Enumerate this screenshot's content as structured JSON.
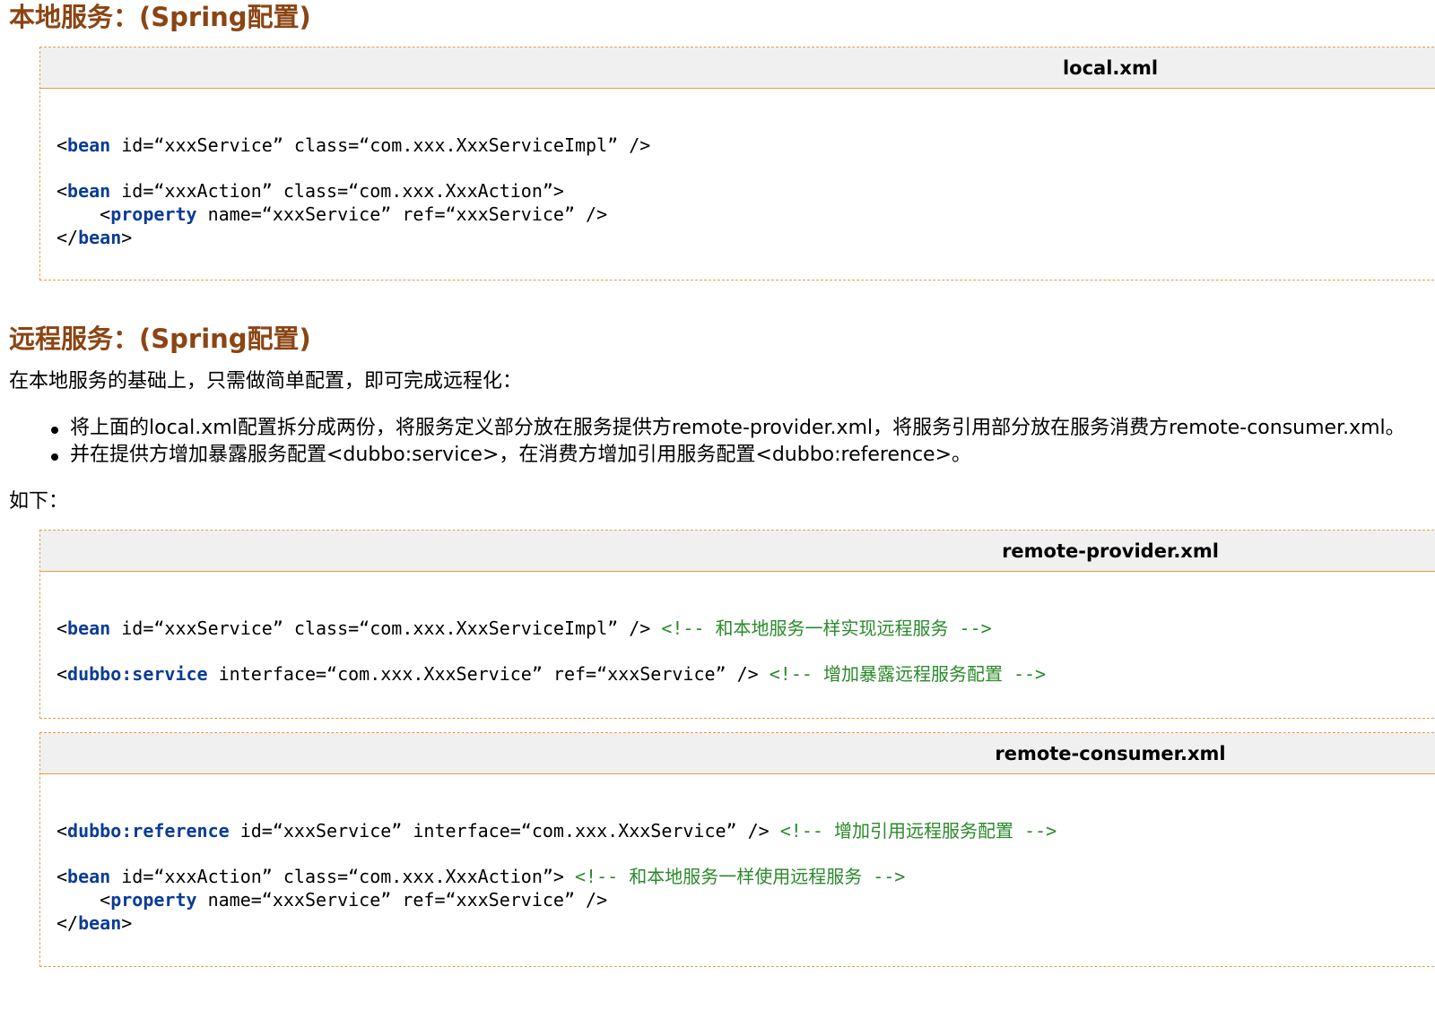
{
  "section1": {
    "heading": "本地服务：(Spring配置)",
    "file_title": "local.xml",
    "lines": [
      [],
      [],
      [
        {
          "t": "<"
        },
        {
          "t": "bean",
          "c": "tag"
        },
        {
          "t": " id=“xxxService” class=“com.xxx.XxxServiceImpl” />"
        }
      ],
      [],
      [
        {
          "t": "<"
        },
        {
          "t": "bean",
          "c": "tag"
        },
        {
          "t": " id=“xxxAction” class=“com.xxx.XxxAction”>"
        }
      ],
      [
        {
          "t": "    <"
        },
        {
          "t": "property",
          "c": "tag"
        },
        {
          "t": " name=“xxxService” ref=“xxxService” />"
        }
      ],
      [
        {
          "t": "</"
        },
        {
          "t": "bean",
          "c": "tag"
        },
        {
          "t": ">"
        }
      ]
    ]
  },
  "section2": {
    "heading": "远程服务：(Spring配置)",
    "intro": "在本地服务的基础上，只需做简单配置，即可完成远程化：",
    "bullets": [
      "将上面的local.xml配置拆分成两份，将服务定义部分放在服务提供方remote-provider.xml，将服务引用部分放在服务消费方remote-consumer.xml。",
      "并在提供方增加暴露服务配置<dubbo:service>，在消费方增加引用服务配置<dubbo:reference>。"
    ],
    "as_follows": "如下："
  },
  "provider": {
    "file_title": "remote-provider.xml",
    "lines": [
      [],
      [],
      [
        {
          "t": "<"
        },
        {
          "t": "bean",
          "c": "tag"
        },
        {
          "t": " id=“xxxService” class=“com.xxx.XxxServiceImpl” /> "
        },
        {
          "t": "<!-- 和本地服务一样实现远程服务 -->",
          "c": "cmt"
        }
      ],
      [],
      [
        {
          "t": "<"
        },
        {
          "t": "dubbo:service",
          "c": "tag"
        },
        {
          "t": " interface=“com.xxx.XxxService” ref=“xxxService” /> "
        },
        {
          "t": "<!-- 增加暴露远程服务配置 -->",
          "c": "cmt"
        }
      ]
    ]
  },
  "consumer": {
    "file_title": "remote-consumer.xml",
    "lines": [
      [],
      [],
      [
        {
          "t": "<"
        },
        {
          "t": "dubbo:reference",
          "c": "tag"
        },
        {
          "t": " id=“xxxService” interface=“com.xxx.XxxService” /> "
        },
        {
          "t": "<!-- 增加引用远程服务配置 -->",
          "c": "cmt"
        }
      ],
      [],
      [
        {
          "t": "<"
        },
        {
          "t": "bean",
          "c": "tag"
        },
        {
          "t": " id=“xxxAction” class=“com.xxx.XxxAction”> "
        },
        {
          "t": "<!-- 和本地服务一样使用远程服务 -->",
          "c": "cmt"
        }
      ],
      [
        {
          "t": "    <"
        },
        {
          "t": "property",
          "c": "tag"
        },
        {
          "t": " name=“xxxService” ref=“xxxService” />"
        }
      ],
      [
        {
          "t": "</"
        },
        {
          "t": "bean",
          "c": "tag"
        },
        {
          "t": ">"
        }
      ]
    ]
  }
}
